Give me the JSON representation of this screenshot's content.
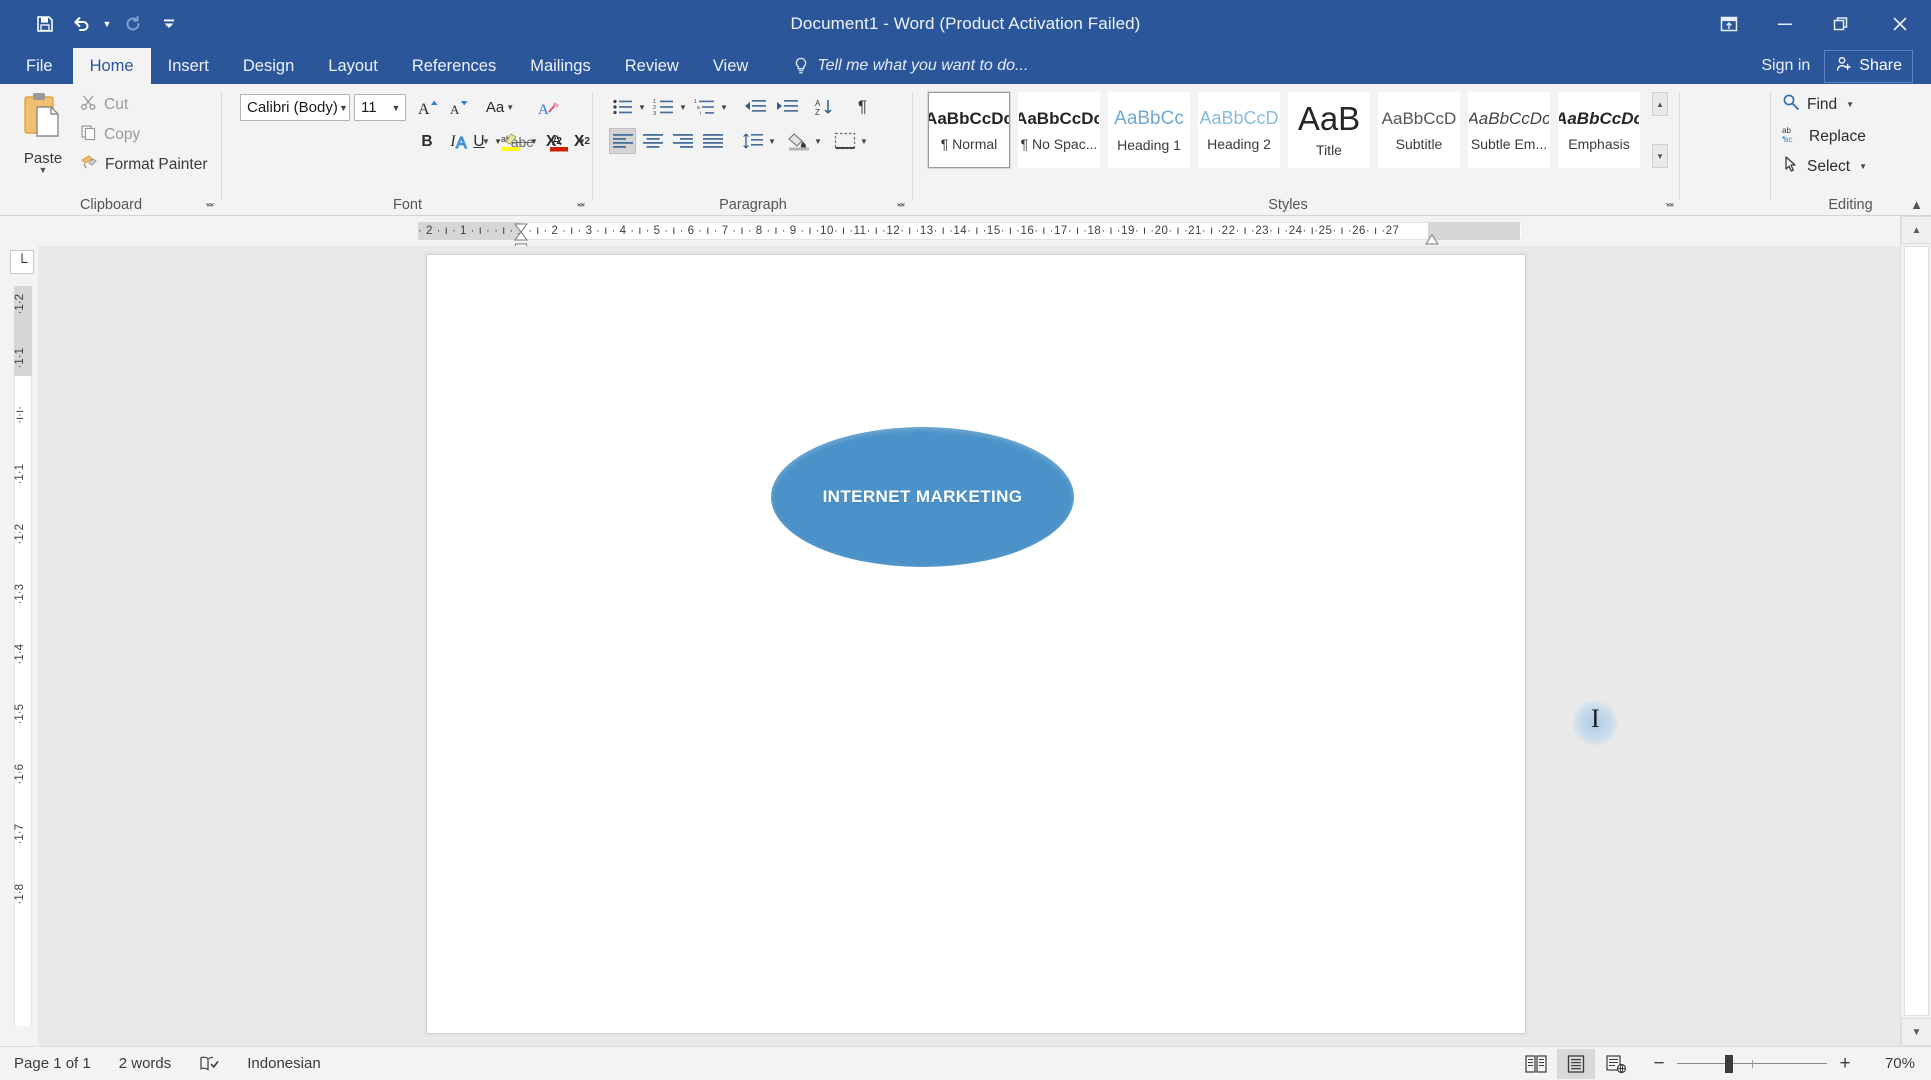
{
  "window": {
    "title": "Document1 - Word (Product Activation Failed)",
    "quick_access": [
      {
        "name": "save",
        "icon": "save-icon"
      },
      {
        "name": "undo",
        "icon": "undo-icon"
      },
      {
        "name": "redo",
        "icon": "redo-icon"
      },
      {
        "name": "customize-quick-access-toolbar",
        "icon": "chevron-down-icon"
      }
    ],
    "controls": {
      "ribbon_display_options": "ribbon-display-options-icon",
      "minimize": "minimize-icon",
      "restore": "restore-icon",
      "close": "close-icon"
    }
  },
  "tabs": [
    {
      "label": "File",
      "active": false
    },
    {
      "label": "Home",
      "active": true
    },
    {
      "label": "Insert",
      "active": false
    },
    {
      "label": "Design",
      "active": false
    },
    {
      "label": "Layout",
      "active": false
    },
    {
      "label": "References",
      "active": false
    },
    {
      "label": "Mailings",
      "active": false
    },
    {
      "label": "Review",
      "active": false
    },
    {
      "label": "View",
      "active": false
    }
  ],
  "tell_me": {
    "placeholder": "Tell me what you want to do...",
    "icon": "lightbulb-icon"
  },
  "account": {
    "sign_in": "Sign in",
    "share": "Share",
    "share_icon": "person-add-icon"
  },
  "ribbon": {
    "clipboard": {
      "label": "Clipboard",
      "paste": "Paste",
      "items": [
        {
          "label": "Cut",
          "icon": "scissors-icon",
          "enabled": false
        },
        {
          "label": "Copy",
          "icon": "copy-icon",
          "enabled": false
        },
        {
          "label": "Format Painter",
          "icon": "format-painter-icon",
          "enabled": true
        }
      ]
    },
    "font": {
      "label": "Font",
      "font_name": "Calibri (Body)",
      "font_size": "11",
      "buttons": [
        {
          "name": "grow-font",
          "glyph": "A"
        },
        {
          "name": "shrink-font",
          "glyph": "A"
        },
        {
          "name": "change-case",
          "glyph": "Aa"
        },
        {
          "name": "clear-formatting",
          "glyph": "A"
        },
        {
          "name": "bold",
          "glyph": "B"
        },
        {
          "name": "italic",
          "glyph": "I"
        },
        {
          "name": "underline",
          "glyph": "U"
        },
        {
          "name": "strikethrough",
          "glyph": "abc"
        },
        {
          "name": "subscript",
          "glyph": "X₂"
        },
        {
          "name": "superscript",
          "glyph": "X²"
        },
        {
          "name": "text-effects",
          "glyph": "A"
        },
        {
          "name": "text-highlight-color",
          "glyph": "ab"
        },
        {
          "name": "font-color",
          "glyph": "A"
        }
      ]
    },
    "paragraph": {
      "label": "Paragraph",
      "buttons": [
        {
          "name": "bullets",
          "icon": "bullet-list-icon"
        },
        {
          "name": "numbering",
          "icon": "numbered-list-icon"
        },
        {
          "name": "multilevel-list",
          "icon": "multilevel-list-icon"
        },
        {
          "name": "decrease-indent",
          "icon": "decrease-indent-icon"
        },
        {
          "name": "increase-indent",
          "icon": "increase-indent-icon"
        },
        {
          "name": "sort",
          "icon": "sort-az-icon"
        },
        {
          "name": "show-formatting-marks",
          "icon": "pilcrow-icon"
        },
        {
          "name": "align-left",
          "icon": "align-left-icon",
          "active": true
        },
        {
          "name": "align-center",
          "icon": "align-center-icon"
        },
        {
          "name": "align-right",
          "icon": "align-right-icon"
        },
        {
          "name": "justify",
          "icon": "justify-icon"
        },
        {
          "name": "line-spacing",
          "icon": "line-spacing-icon"
        },
        {
          "name": "shading",
          "icon": "shading-icon"
        },
        {
          "name": "borders",
          "icon": "borders-icon"
        }
      ]
    },
    "styles": {
      "label": "Styles",
      "items": [
        {
          "preview": "AaBbCcDc",
          "name": "¶ Normal",
          "selected": true,
          "kind": "normal"
        },
        {
          "preview": "AaBbCcDc",
          "name": "¶ No Spac...",
          "selected": false,
          "kind": "normal"
        },
        {
          "preview": "AaBbCс",
          "name": "Heading 1",
          "selected": false,
          "kind": "heading1"
        },
        {
          "preview": "AaBbCcD",
          "name": "Heading 2",
          "selected": false,
          "kind": "heading2"
        },
        {
          "preview": "AaB",
          "name": "Title",
          "selected": false,
          "kind": "title"
        },
        {
          "preview": "AaBbCcD",
          "name": "Subtitle",
          "selected": false,
          "kind": "subtitle"
        },
        {
          "preview": "AaBbCcDc",
          "name": "Subtle Em...",
          "selected": false,
          "kind": "italic"
        },
        {
          "preview": "AaBbCcDc",
          "name": "Emphasis",
          "selected": false,
          "kind": "italic-bold"
        }
      ]
    },
    "editing": {
      "label": "Editing",
      "items": [
        {
          "label": "Find",
          "icon": "search-icon",
          "has_caret": true
        },
        {
          "label": "Replace",
          "icon": "replace-icon",
          "has_caret": false
        },
        {
          "label": "Select",
          "icon": "pointer-icon",
          "has_caret": true
        }
      ]
    }
  },
  "ruler": {
    "horizontal": "· 2 · ı · 1 · ı ·    · ı · 1 · ı · 2 · ı · 3 · ı · 4 · ı · 5 · ı · 6 · ı · 7 · ı · 8 · ı · 9 · ı ·10· ı ·11· ı ·12· ı ·13· ı ·14· ı ·15· ı ·16· ı ·17· ı ·18· ı ·19· ı ·20· ı ·21· ı ·22· ı ·23· ı ·24· ı·25· ı ·26· ı ·27",
    "vertical_ticks": [
      "2",
      "1",
      "ı",
      "1",
      "2",
      "3",
      "4",
      "5",
      "6",
      "7",
      "8"
    ],
    "tab_selector": "└"
  },
  "document": {
    "shape": {
      "type": "ellipse",
      "text": "INTERNET MARKETING",
      "fill_color": "#4b92c8",
      "text_color": "#ffffff"
    }
  },
  "status_bar": {
    "page": "Page 1 of 1",
    "words": "2 words",
    "proofing_icon": "proofing-errors-icon",
    "language": "Indonesian",
    "views": [
      {
        "name": "read-mode",
        "icon": "read-mode-icon",
        "active": false
      },
      {
        "name": "print-layout",
        "icon": "print-layout-icon",
        "active": true
      },
      {
        "name": "web-layout",
        "icon": "web-layout-icon",
        "active": false
      }
    ],
    "zoom_out": "−",
    "zoom_in": "+",
    "zoom_level": "70%"
  },
  "cursor": {
    "type": "text-ibeam",
    "glyph": "I"
  }
}
